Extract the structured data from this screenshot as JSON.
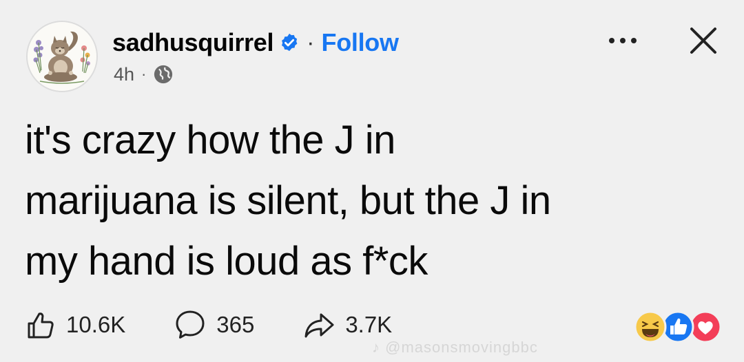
{
  "post": {
    "author": {
      "username": "sadhusquirrel",
      "verified_icon": "verified-badge-icon",
      "separator": "·",
      "follow_label": "Follow"
    },
    "meta": {
      "time": "4h",
      "separator": "·",
      "privacy_icon": "globe-icon"
    },
    "text_lines": [
      "it's crazy how the J in",
      "marijuana is silent, but the J in",
      "my hand is loud as f*ck"
    ],
    "actions": {
      "likes": "10.6K",
      "comments": "365",
      "shares": "3.7K"
    },
    "reactions": [
      "haha",
      "like",
      "love"
    ],
    "watermark": "♪ @masonsmovingbbc"
  },
  "colors": {
    "background": "#f0f0f0",
    "follow_blue": "#1877f2",
    "verified_blue": "#1877f2",
    "like_blue": "#1877f2",
    "love_red": "#f33e58",
    "haha_yellow": "#f7c94a"
  }
}
